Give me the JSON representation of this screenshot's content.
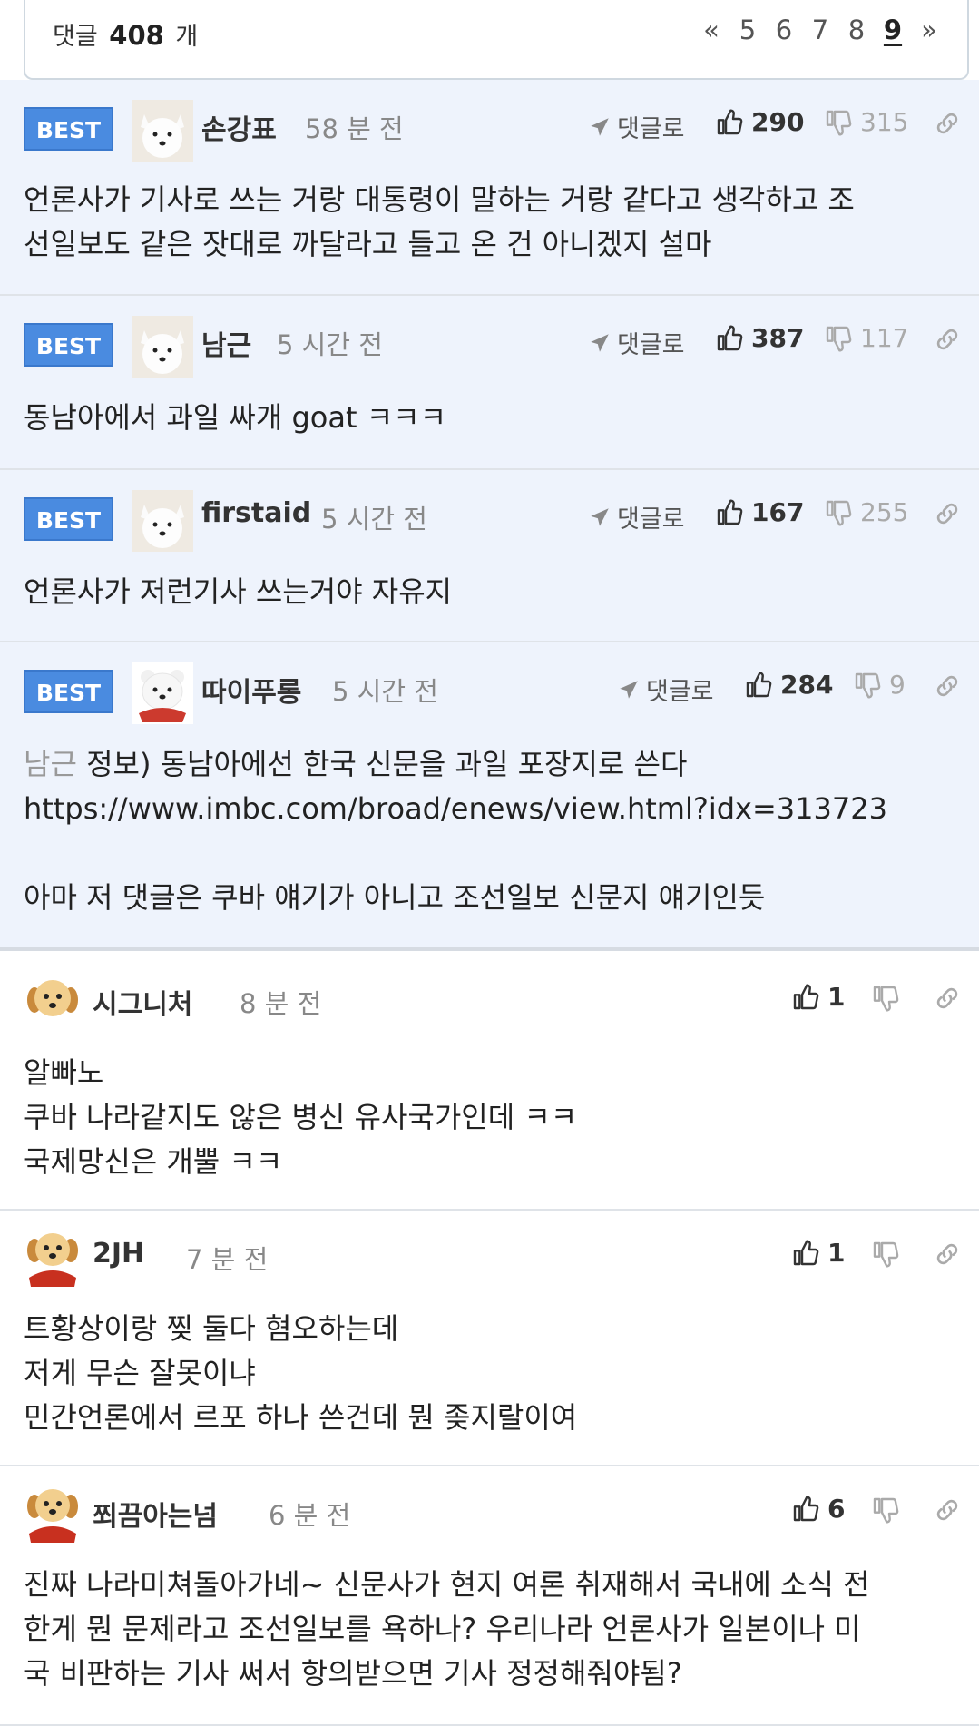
{
  "header": {
    "count_prefix": "댓글",
    "count": "408",
    "count_suffix": "개",
    "pages": [
      "«",
      "5",
      "6",
      "7",
      "8",
      "9",
      "»"
    ],
    "current_page": "9"
  },
  "labels": {
    "best": "BEST",
    "reply": "댓글로"
  },
  "best_comments": [
    {
      "author": "손강표",
      "time": "58 분 전",
      "likes": "290",
      "dislikes": "315",
      "text": "언론사가 기사로 쓰는 거랑 대통령이 말하는 거랑 같다고 생각하고 조\n선일보도 같은 잣대로 까달라고 들고 온 건 아니겠지 설마"
    },
    {
      "author": "남근",
      "time": "5 시간 전",
      "likes": "387",
      "dislikes": "117",
      "text": "동남아에서 과일 싸개 goat ㅋㅋㅋ"
    },
    {
      "author": "firstaid",
      "time": "5 시간 전",
      "likes": "167",
      "dislikes": "255",
      "text": "언론사가 저런기사 쓰는거야 자유지"
    },
    {
      "author": "따이푸롱",
      "time": "5 시간 전",
      "likes": "284",
      "dislikes": "9",
      "quote_name": "남근",
      "quote_text": " 정보) 동남아에선 한국 신문을 과일 포장지로 쓴다",
      "text": "https://www.imbc.com/broad/enews/view.html?idx=313723\n\n아마 저 댓글은 쿠바 얘기가 아니고 조선일보 신문지 얘기인듯"
    }
  ],
  "comments": [
    {
      "author": "시그니처",
      "time": "8 분 전",
      "likes": "1",
      "text": "알빠노\n쿠바 나라같지도 않은 병신 유사국가인데 ㅋㅋ\n국제망신은 개뿔 ㅋㅋ"
    },
    {
      "author": "2JH",
      "time": "7 분 전",
      "likes": "1",
      "text": "트황상이랑 찢 둘다 혐오하는데\n저게 무슨 잘못이냐\n민간언론에서 르포 하나 쓴건데 뭔 좆지랄이여"
    },
    {
      "author": "쬐끔아는넘",
      "time": "6 분 전",
      "likes": "6",
      "text": "진짜 나라미쳐돌아가네~ 신문사가 현지 여론 취재해서 국내에 소식 전\n한게 뭔 문제라고 조선일보를 욕하나? 우리나라 언론사가 일본이나 미\n국 비판하는 기사 써서 항의받으면 기사 정정해줘야됨?"
    }
  ],
  "colors": {
    "best_bg": "#eef3fc",
    "badge": "#4a8be0"
  },
  "icons": [
    "thumbs-up-icon",
    "thumbs-down-icon",
    "paper-plane-icon",
    "link-icon",
    "white-dog-avatar",
    "puppy-avatar"
  ]
}
